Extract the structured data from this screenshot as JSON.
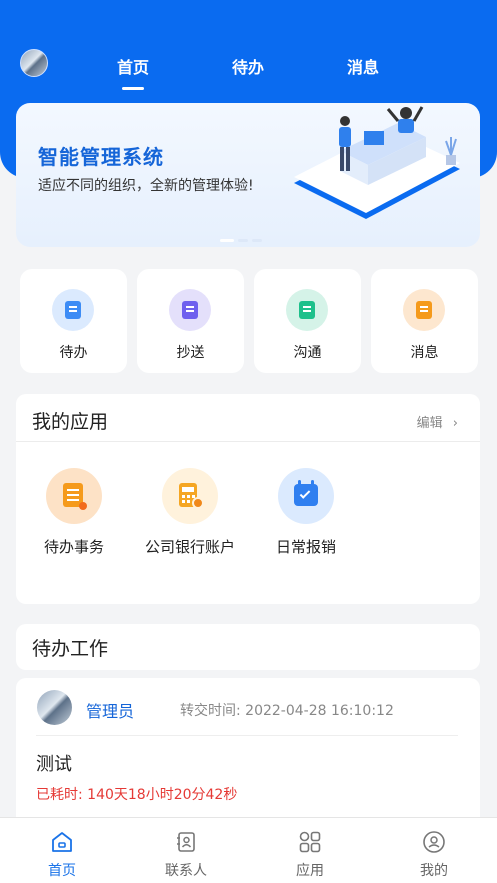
{
  "header": {
    "tabs": [
      {
        "label": "首页",
        "active": true
      },
      {
        "label": "待办",
        "active": false
      },
      {
        "label": "消息",
        "active": false
      }
    ]
  },
  "banner": {
    "title": "智能管理系统",
    "subtitle": "适应不同的组织，全新的管理体验!"
  },
  "quick_actions": [
    {
      "label": "待办",
      "icon": "todo-doc-icon",
      "color": "#3d8cf5"
    },
    {
      "label": "抄送",
      "icon": "cc-doc-icon",
      "color": "#6f60ee"
    },
    {
      "label": "沟通",
      "icon": "chat-doc-icon",
      "color": "#1ec08b"
    },
    {
      "label": "消息",
      "icon": "message-doc-icon",
      "color": "#f59a1b"
    }
  ],
  "my_apps": {
    "title": "我的应用",
    "edit_label": "编辑",
    "items": [
      {
        "label": "待办事务",
        "icon": "task-icon"
      },
      {
        "label": "公司银行账户",
        "icon": "bank-account-icon"
      },
      {
        "label": "日常报销",
        "icon": "calendar-check-icon"
      }
    ]
  },
  "todo_work": {
    "title": "待办工作",
    "item": {
      "user": "管理员",
      "transfer_label": "转交时间:",
      "transfer_time": "2022-04-28 16:10:12",
      "subject": "测试",
      "elapsed": "已耗时: 140天18小时20分42秒"
    }
  },
  "tab_bar": [
    {
      "label": "首页",
      "icon": "home-icon",
      "active": true
    },
    {
      "label": "联系人",
      "icon": "contacts-icon",
      "active": false
    },
    {
      "label": "应用",
      "icon": "apps-icon",
      "active": false
    },
    {
      "label": "我的",
      "icon": "profile-icon",
      "active": false
    }
  ],
  "colors": {
    "primary": "#0a6bf0",
    "accent_text": "#1565d8",
    "elapsed_red": "#e53935"
  }
}
